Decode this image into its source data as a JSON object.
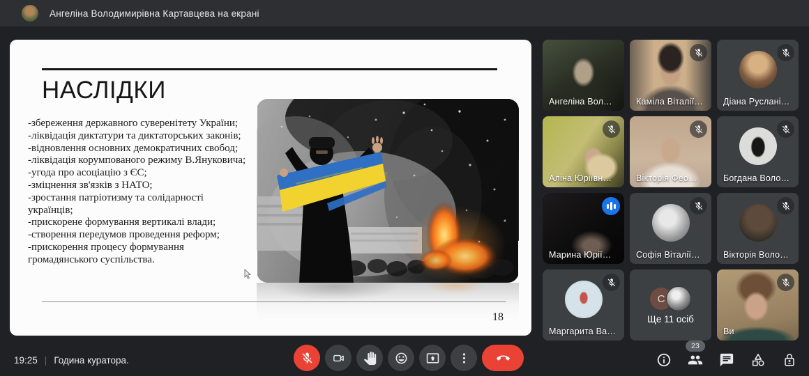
{
  "top_bar": {
    "presenter_status": "Ангеліна Володимирівна Картавцева на екрані"
  },
  "slide": {
    "title": "НАСЛІДКИ",
    "body_lines": [
      "-збереження державного суверенітету України;",
      "-ліквідація диктатури та диктаторських законів;",
      "-відновлення основних демократичних свобод;",
      "-ліквідація корумпованого режиму В.Януковича;",
      "-угода про асоціацію з ЄС;",
      "-зміцнення зв'язків з НАТО;",
      "-зростання патріотизму та солідарності",
      "українців;",
      "-прискорене формування вертикалі влади;",
      "-створення передумов проведення реформ;",
      "-прискорення процесу формування",
      "громадянського суспільства."
    ],
    "page_number": "18",
    "image_description": "протестувальник з прапором України, дим та вогонь на Майдані"
  },
  "participants": [
    {
      "name": "Ангеліна Вол…",
      "muted": false,
      "video": true
    },
    {
      "name": "Каміла Віталії…",
      "muted": true,
      "video": true
    },
    {
      "name": "Діана Руслані…",
      "muted": true,
      "video": false
    },
    {
      "name": "Аліна Юріївн…",
      "muted": true,
      "video": true
    },
    {
      "name": "Вікторія Фео…",
      "muted": true,
      "video": true
    },
    {
      "name": "Богдана Воло…",
      "muted": true,
      "video": false
    },
    {
      "name": "Марина Юрії…",
      "muted": false,
      "speaking": true,
      "video": true
    },
    {
      "name": "Софія Віталії…",
      "muted": true,
      "video": false
    },
    {
      "name": "Вікторія Воло…",
      "muted": true,
      "video": false
    },
    {
      "name": "Маргарита Ва…",
      "muted": true,
      "video": false
    },
    {
      "name": "Ще 11 осіб",
      "overflow_letter": "C",
      "video": false
    },
    {
      "name": "Ви",
      "muted": true,
      "video": true
    }
  ],
  "bottom_bar": {
    "time": "19:25",
    "separator": "|",
    "meeting_name": "Година куратора."
  },
  "controls": {
    "mic": {
      "icon": "mic-off-icon",
      "state": "muted"
    },
    "camera": {
      "icon": "camera-icon"
    },
    "hand": {
      "icon": "raise-hand-icon"
    },
    "reactions": {
      "icon": "reactions-icon"
    },
    "present": {
      "icon": "present-screen-icon"
    },
    "more": {
      "icon": "more-options-icon"
    },
    "leave": {
      "icon": "end-call-icon"
    }
  },
  "panel": {
    "badge": "23",
    "icons": [
      "info-icon",
      "people-icon",
      "chat-icon",
      "activities-icon",
      "host-controls-icon"
    ]
  },
  "colors": {
    "page_bg": "#202124",
    "top_bar_bg": "#2e2f33",
    "tile_bg": "#3c4043",
    "danger_red": "#ea4335",
    "accent_blue": "#1a73e8",
    "speaking_border": "#5b94f7",
    "flag_blue": "#2f6fc4",
    "flag_yellow": "#f2d22e"
  }
}
